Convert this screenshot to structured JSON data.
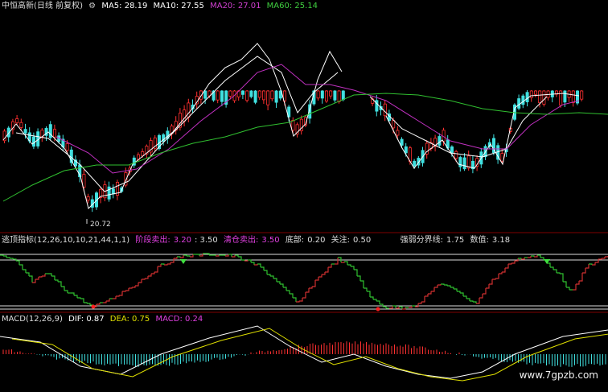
{
  "main_panel": {
    "stock_name": "中恒高新(日线 前复权)",
    "gear_icon": "gear-icon",
    "ma_items": [
      {
        "label": "MA5: 28.19",
        "color": "#ffffff"
      },
      {
        "label": "MA10: 27.55",
        "color": "#ffffff"
      },
      {
        "label": "MA20: 27.01",
        "color": "#d040d0"
      },
      {
        "label": "MA60: 25.14",
        "color": "#40d040"
      }
    ],
    "low_marker": "20.72"
  },
  "indicator_panel": {
    "title": "逃顶指标(12,26,10,10,21,44,1,1)",
    "items": [
      {
        "label": "阶段卖出:",
        "value": "3.20",
        "color": "#e040e0"
      },
      {
        "label": "",
        "value": ": 3.50",
        "color": "#ddd"
      },
      {
        "label": "清仓卖出:",
        "value": "3.50",
        "color": "#e040e0"
      },
      {
        "label": "底部:",
        "value": "0.20",
        "color": "#ddd"
      },
      {
        "label": "关注:",
        "value": "0.50",
        "color": "#ddd"
      },
      {
        "label": "强弱分界线:",
        "value": "1.75",
        "color": "#ddd"
      },
      {
        "label": "数值:",
        "value": "3.18",
        "color": "#ddd"
      }
    ]
  },
  "macd_panel": {
    "title": "MACD(12,26,9)",
    "items": [
      {
        "label": "DIF: 0.87",
        "color": "#ffffff"
      },
      {
        "label": "DEA: 0.75",
        "color": "#e0e000"
      },
      {
        "label": "MACD: 0.24",
        "color": "#e040e0"
      }
    ]
  },
  "watermark": "www.7gpzb.com",
  "colors": {
    "up": "#ff3030",
    "down": "#40e0e0",
    "ma5": "#ffffff",
    "ma10": "#ffffff",
    "ma20": "#c030c0",
    "ma60": "#30c030",
    "ind_up": "#d03030",
    "ind_down": "#30c030"
  }
}
